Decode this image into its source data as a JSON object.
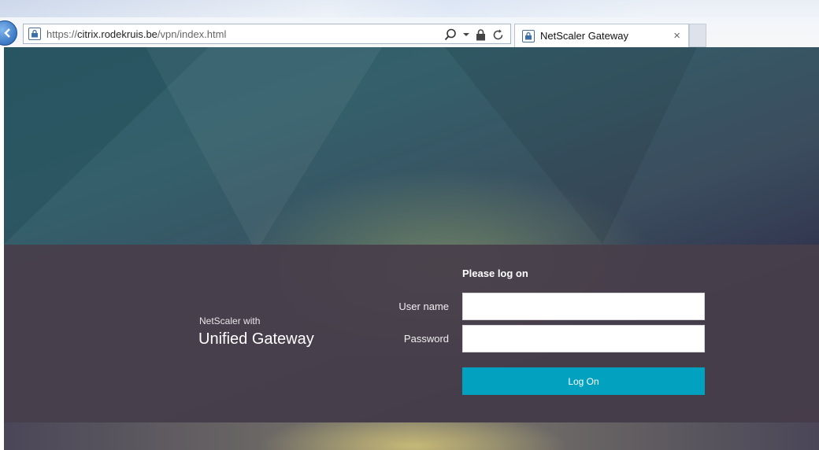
{
  "browser": {
    "url_scheme": "https://",
    "url_host": "citrix.rodekruis.be",
    "url_path": "/vpn/index.html",
    "tab_title": "NetScaler Gateway",
    "tab_close": "×",
    "icons": [
      "back-icon",
      "site-lock-icon",
      "search-icon",
      "dropdown-icon",
      "lock-icon",
      "refresh-icon",
      "close-icon"
    ]
  },
  "branding": {
    "subtitle": "NetScaler with",
    "title": "Unified Gateway"
  },
  "login": {
    "heading": "Please log on",
    "username_label": "User name",
    "username_value": "",
    "password_label": "Password",
    "password_value": "",
    "button_label": "Log On"
  },
  "colors": {
    "band": "#483e4a",
    "button": "#02a1c0",
    "text": "#ffffff"
  }
}
